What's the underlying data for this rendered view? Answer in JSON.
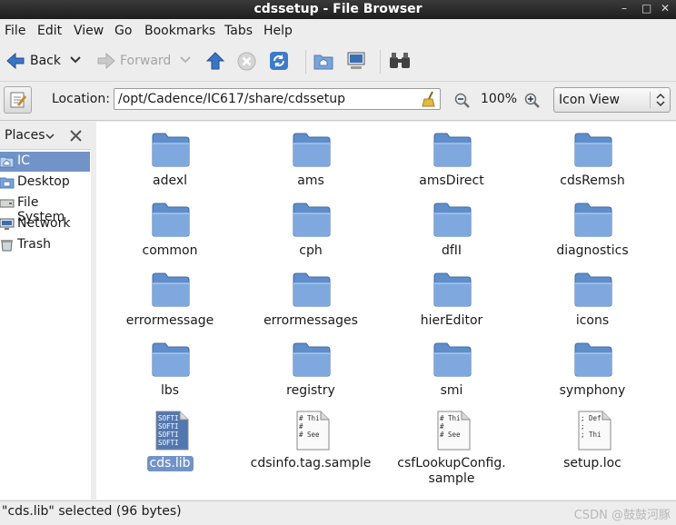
{
  "window": {
    "title": "cdssetup - File Browser"
  },
  "menu": [
    "File",
    "Edit",
    "View",
    "Go",
    "Bookmarks",
    "Tabs",
    "Help"
  ],
  "toolbar": {
    "back_label": "Back",
    "forward_label": "Forward"
  },
  "location": {
    "label": "Location:",
    "path": "/opt/Cadence/IC617/share/cdssetup",
    "zoom": "100%",
    "view_mode": "Icon View"
  },
  "sidebar": {
    "header": "Places",
    "items": [
      {
        "label": "IC",
        "icon": "home-folder-icon"
      },
      {
        "label": "Desktop",
        "icon": "desktop-icon"
      },
      {
        "label": "File System",
        "icon": "drive-icon"
      },
      {
        "label": "Network",
        "icon": "network-icon"
      },
      {
        "label": "Trash",
        "icon": "trash-icon"
      }
    ]
  },
  "files": [
    {
      "label": "adexl",
      "type": "folder"
    },
    {
      "label": "ams",
      "type": "folder"
    },
    {
      "label": "amsDirect",
      "type": "folder"
    },
    {
      "label": "cdsRemsh",
      "type": "folder"
    },
    {
      "label": "common",
      "type": "folder"
    },
    {
      "label": "cph",
      "type": "folder"
    },
    {
      "label": "dfII",
      "type": "folder"
    },
    {
      "label": "diagnostics",
      "type": "folder"
    },
    {
      "label": "errormessage",
      "type": "folder"
    },
    {
      "label": "errormessages",
      "type": "folder"
    },
    {
      "label": "hierEditor",
      "type": "folder"
    },
    {
      "label": "icons",
      "type": "folder"
    },
    {
      "label": "lbs",
      "type": "folder"
    },
    {
      "label": "registry",
      "type": "folder"
    },
    {
      "label": "smi",
      "type": "folder"
    },
    {
      "label": "symphony",
      "type": "folder"
    },
    {
      "label": "cds.lib",
      "type": "file",
      "preview": [
        "SOFTI",
        "SOFTI",
        "SOFTI",
        "SOFTI"
      ],
      "selected": true
    },
    {
      "label": "cdsinfo.tag.sample",
      "type": "file",
      "preview": [
        "# Thi",
        "#",
        "# See"
      ]
    },
    {
      "label": "csfLookupConfig.\nsample",
      "type": "file",
      "preview": [
        "# Thi",
        "#",
        "# See"
      ]
    },
    {
      "label": "setup.loc",
      "type": "file",
      "preview": [
        "; Def",
        ";",
        "; Thi"
      ]
    }
  ],
  "status": {
    "text": "\"cds.lib\" selected (96 bytes)"
  },
  "watermark": "CSDN @鼓鼓河豚",
  "colors": {
    "selection": "#7293c7",
    "folder": "#6f9ad3"
  }
}
